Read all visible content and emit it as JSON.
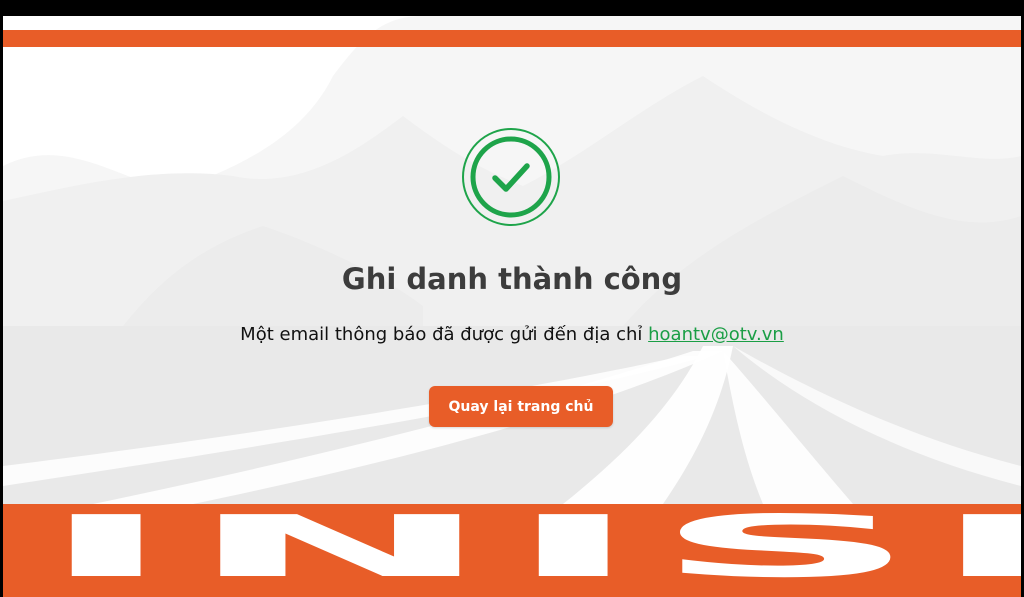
{
  "success": {
    "icon": "check-circle-icon",
    "title": "Ghi danh thành công",
    "message_prefix": "Một email thông báo đã được gửi đến địa chỉ ",
    "email": "hoantv@otv.vn"
  },
  "actions": {
    "home_label": "Quay lại trang chủ"
  },
  "banner": {
    "finish_text": "FINISH"
  },
  "colors": {
    "accent": "#e85d28",
    "success": "#1ea44a",
    "link": "#1a9e45",
    "title": "#3c3c3c"
  }
}
